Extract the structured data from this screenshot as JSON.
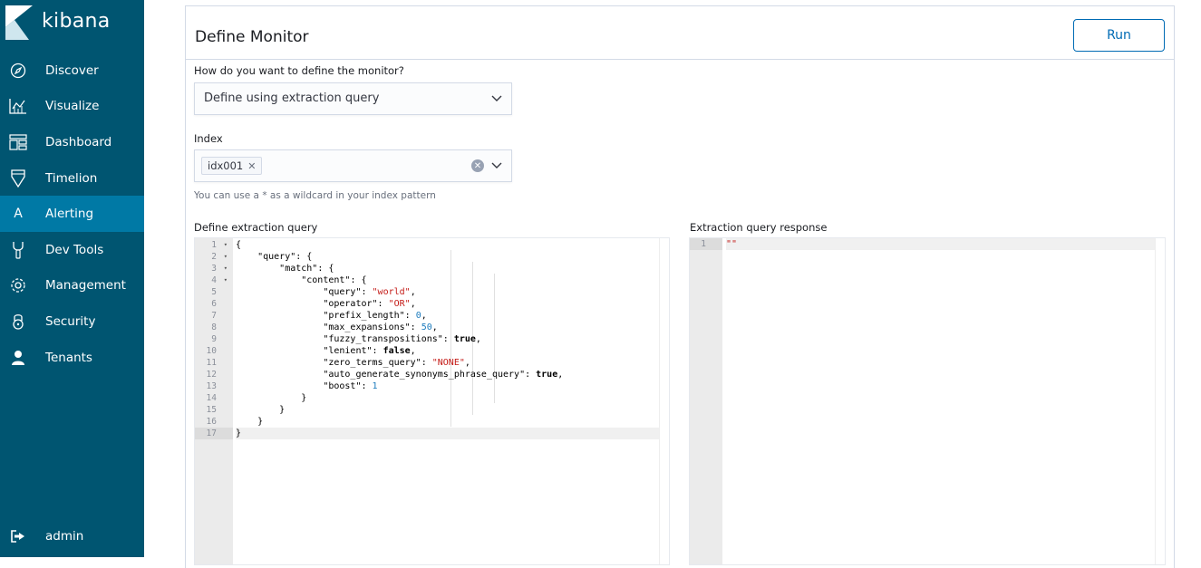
{
  "sidebar": {
    "brand": "kibana",
    "items": [
      {
        "label": "Discover",
        "icon": "compass-icon"
      },
      {
        "label": "Visualize",
        "icon": "visualize-icon"
      },
      {
        "label": "Dashboard",
        "icon": "dashboard-icon"
      },
      {
        "label": "Timelion",
        "icon": "timelion-icon"
      },
      {
        "label": "Alerting",
        "icon": "alerting-letter-icon",
        "active": true,
        "glyph": "A"
      },
      {
        "label": "Dev Tools",
        "icon": "wrench-icon"
      },
      {
        "label": "Management",
        "icon": "gear-icon"
      },
      {
        "label": "Security",
        "icon": "lock-icon"
      },
      {
        "label": "Tenants",
        "icon": "user-icon"
      }
    ],
    "user": {
      "label": "admin",
      "icon": "logout-icon"
    }
  },
  "panel": {
    "title": "Define Monitor",
    "run_label": "Run",
    "define_question": "How do you want to define the monitor?",
    "define_value": "Define using extraction query",
    "index_label": "Index",
    "index_chip": "idx001",
    "index_help": "You can use a * as a wildcard in your index pattern",
    "query_label": "Define extraction query",
    "response_label": "Extraction query response"
  },
  "query_lines": [
    "{",
    "    \"query\": {",
    "        \"match\": {",
    "            \"content\": {",
    "                \"query\": \"world\",",
    "                \"operator\": \"OR\",",
    "                \"prefix_length\": 0,",
    "                \"max_expansions\": 50,",
    "                \"fuzzy_transpositions\": true,",
    "                \"lenient\": false,",
    "                \"zero_terms_query\": \"NONE\",",
    "                \"auto_generate_synonyms_phrase_query\": true,",
    "                \"boost\": 1",
    "            }",
    "        }",
    "    }",
    "}"
  ],
  "response_lines": [
    "\"\""
  ],
  "colors": {
    "sidebar": "#005571",
    "active": "#0079a5",
    "primary": "#006bb4"
  }
}
